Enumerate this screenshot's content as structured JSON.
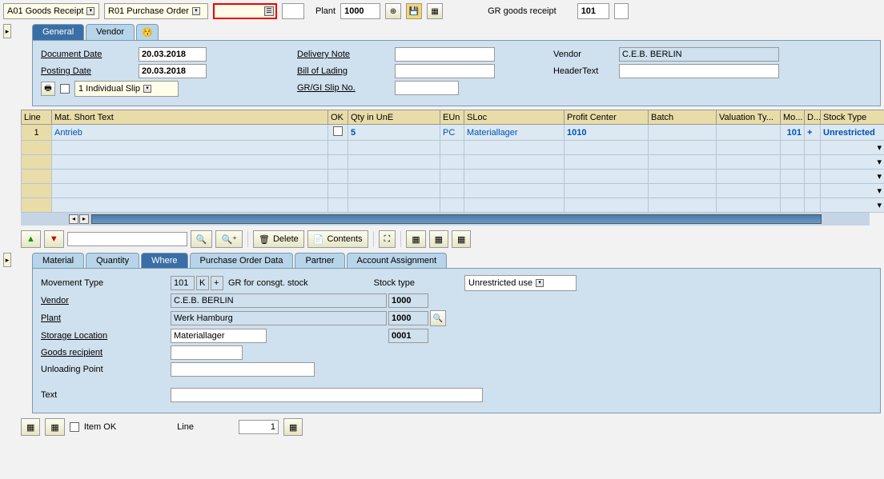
{
  "topbar": {
    "action": "A01 Goods Receipt",
    "ref": "R01 Purchase Order",
    "po_value": "",
    "plant_label": "Plant",
    "plant_value": "1000",
    "gr_label": "GR goods receipt",
    "gr_code": "101"
  },
  "headerTabs": {
    "general": "General",
    "vendor": "Vendor"
  },
  "header": {
    "docDateLbl": "Document Date",
    "docDate": "20.03.2018",
    "postDateLbl": "Posting Date",
    "postDate": "20.03.2018",
    "indivSlip": "1 Individual Slip",
    "delivNoteLbl": "Delivery Note",
    "delivNote": "",
    "bolLbl": "Bill of Lading",
    "bol": "",
    "grgiLbl": "GR/GI Slip No.",
    "grgi": "",
    "vendorLbl": "Vendor",
    "vendor": "C.E.B. BERLIN",
    "headerTextLbl": "HeaderText",
    "headerText": ""
  },
  "gridCols": {
    "line": "Line",
    "mat": "Mat. Short Text",
    "ok": "OK",
    "qty": "Qty in UnE",
    "eun": "EUn",
    "sloc": "SLoc",
    "pc": "Profit Center",
    "batch": "Batch",
    "vt": "Valuation Ty...",
    "mo": "Mo...",
    "d": "D...",
    "st": "Stock Type"
  },
  "gridRow": {
    "line": "1",
    "mat": "Antrieb",
    "qty": "5",
    "eun": "PC",
    "sloc": "Materiallager",
    "pc": "1010",
    "mo": "101",
    "d": "+",
    "st": "Unrestricted"
  },
  "midToolbar": {
    "delete": "Delete",
    "contents": "Contents"
  },
  "detailTabs": {
    "material": "Material",
    "quantity": "Quantity",
    "where": "Where",
    "pod": "Purchase Order Data",
    "partner": "Partner",
    "aa": "Account Assignment"
  },
  "detail": {
    "mtLbl": "Movement Type",
    "mtCode": "101",
    "mtK": "K",
    "mtPlus": "+",
    "mtText": "GR for consgt. stock",
    "stLbl": "Stock type",
    "stVal": "Unrestricted use",
    "vendorLbl": "Vendor",
    "vendor": "C.E.B. BERLIN",
    "vendorCode": "1000",
    "plantLbl": "Plant",
    "plant": "Werk Hamburg",
    "plantCode": "1000",
    "slocLbl": "Storage Location",
    "sloc": "Materiallager",
    "slocCode": "0001",
    "grLbl": "Goods recipient",
    "gr": "",
    "upLbl": "Unloading Point",
    "up": "",
    "textLbl": "Text",
    "text": ""
  },
  "bottom": {
    "itemOk": "Item OK",
    "lineLbl": "Line",
    "lineVal": "1"
  }
}
